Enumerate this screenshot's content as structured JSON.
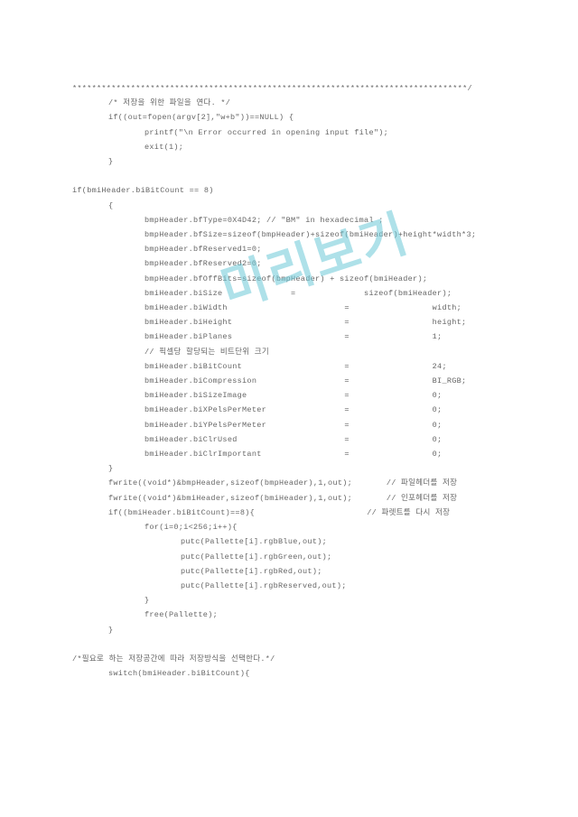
{
  "watermark": "미리보기",
  "lines": [
    {
      "cls": "",
      "t": "*********************************************************************************/"
    },
    {
      "cls": "indent1",
      "t": "/* 저장을 위한 파일을 연다. */"
    },
    {
      "cls": "indent1",
      "t": "if((out=fopen(argv[2],\"w+b\"))==NULL) {"
    },
    {
      "cls": "indent2",
      "t": "printf(\"\\n Error occurred in opening input file\");"
    },
    {
      "cls": "indent2",
      "t": "exit(1);"
    },
    {
      "cls": "indent1",
      "t": "}"
    },
    {
      "cls": "",
      "t": " "
    },
    {
      "cls": "",
      "t": "if(bmiHeader.biBitCount == 8)"
    },
    {
      "cls": "indent1",
      "t": "{"
    },
    {
      "cls": "indent2",
      "t": "bmpHeader.bfType=0X4D42; // \"BM\" in hexadecimal ;"
    },
    {
      "cls": "indent2",
      "t": "bmpHeader.bfSize=sizeof(bmpHeader)+sizeof(bmiHeader)+height*width*3;"
    },
    {
      "cls": "indent2",
      "t": "bmpHeader.bfReserved1=0;"
    },
    {
      "cls": "indent2",
      "t": "bmpHeader.bfReserved2=0;"
    },
    {
      "cls": "indent2",
      "t": "bmpHeader.bfOffBits=sizeof(bmpHeader) + sizeof(bmiHeader);"
    },
    {
      "cls": "indent2",
      "t": "bmiHeader.biSize              =              sizeof(bmiHeader);"
    },
    {
      "cls": "indent2",
      "t": "bmiHeader.biWidth                        =                 width;"
    },
    {
      "cls": "indent2",
      "t": "bmiHeader.biHeight                       =                 height;"
    },
    {
      "cls": "indent2",
      "t": "bmiHeader.biPlanes                       =                 1;"
    },
    {
      "cls": "indent2",
      "t": "// 픽셀당 할당되는 비트단위 크기"
    },
    {
      "cls": "indent2",
      "t": "bmiHeader.biBitCount                     =                 24;"
    },
    {
      "cls": "indent2",
      "t": "bmiHeader.biCompression                  =                 BI_RGB;"
    },
    {
      "cls": "indent2",
      "t": "bmiHeader.biSizeImage                    =                 0;"
    },
    {
      "cls": "indent2",
      "t": "bmiHeader.biXPelsPerMeter                =                 0;"
    },
    {
      "cls": "indent2",
      "t": "bmiHeader.biYPelsPerMeter                =                 0;"
    },
    {
      "cls": "indent2",
      "t": "bmiHeader.biClrUsed                      =                 0;"
    },
    {
      "cls": "indent2",
      "t": "bmiHeader.biClrImportant                 =                 0;"
    },
    {
      "cls": "indent1",
      "t": "}"
    },
    {
      "cls": "indent1",
      "t": "fwrite((void*)&bmpHeader,sizeof(bmpHeader),1,out);       // 파일헤더를 저장"
    },
    {
      "cls": "indent1",
      "t": "fwrite((void*)&bmiHeader,sizeof(bmiHeader),1,out);       // 인포헤더를 저장"
    },
    {
      "cls": "indent1",
      "t": "if((bmiHeader.biBitCount)==8){                       // 파렛트를 다시 저장"
    },
    {
      "cls": "indent2",
      "t": "for(i=0;i<256;i++){"
    },
    {
      "cls": "indent3",
      "t": "putc(Pallette[i].rgbBlue,out);"
    },
    {
      "cls": "indent3",
      "t": "putc(Pallette[i].rgbGreen,out);"
    },
    {
      "cls": "indent3",
      "t": "putc(Pallette[i].rgbRed,out);"
    },
    {
      "cls": "indent3",
      "t": "putc(Pallette[i].rgbReserved,out);"
    },
    {
      "cls": "indent2",
      "t": "}"
    },
    {
      "cls": "indent2",
      "t": "free(Pallette);"
    },
    {
      "cls": "indent1",
      "t": "}"
    },
    {
      "cls": "",
      "t": " "
    },
    {
      "cls": "",
      "t": "/*필요로 하는 저장공간에 따라 저장방식을 선택한다.*/"
    },
    {
      "cls": "indent1",
      "t": "switch(bmiHeader.biBitCount){"
    }
  ]
}
